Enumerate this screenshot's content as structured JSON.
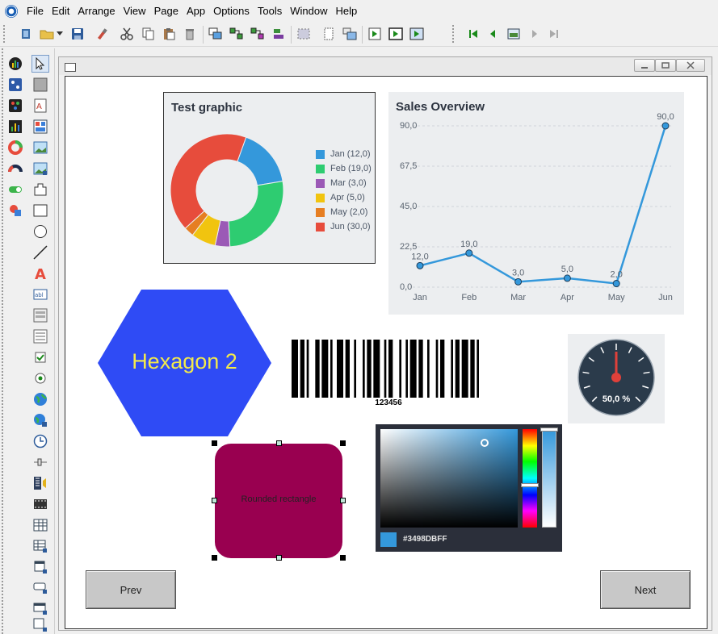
{
  "menu": {
    "items": [
      "File",
      "Edit",
      "Arrange",
      "View",
      "Page",
      "App",
      "Options",
      "Tools",
      "Window",
      "Help"
    ]
  },
  "toolbar": {
    "icons": [
      "new-screen-icon",
      "open-folder-icon",
      "dropdown-arrow-icon",
      "save-icon",
      "format-brush-icon",
      "cut-icon",
      "copy-icon",
      "paste-icon",
      "delete-icon",
      "bring-front-icon",
      "group-icon",
      "ungroup-icon",
      "align-icon",
      "select-all-icon",
      "new-page-icon",
      "pages-icon",
      "run-icon",
      "run-window-icon",
      "run-fullscreen-icon",
      "first-page-icon",
      "previous-page-icon",
      "page-icon",
      "next-page-icon",
      "last-page-icon"
    ]
  },
  "toolbox": {
    "icons": [
      "chart-icon",
      "pointer-icon",
      "layout-icon",
      "rectangle-fill-icon",
      "palette-icon",
      "text-doc-icon",
      "bar-chart-icon",
      "report-icon",
      "donut-icon",
      "image-icon",
      "gauge-icon",
      "image-edit-icon",
      "toggle-icon",
      "shape-icon",
      "cube-icon",
      "rectangle-icon",
      "ellipse-icon",
      "line-icon",
      "text-icon",
      "textbox-icon",
      "form-icon",
      "list-icon",
      "checkbox-icon",
      "radio-icon",
      "globe-icon",
      "web-icon",
      "clock-icon",
      "slider-icon",
      "media-icon",
      "film-icon",
      "table-icon",
      "table-edit-icon",
      "panel-icon",
      "window-icon",
      "dialog-icon",
      "subscreen-icon"
    ]
  },
  "pie_chart": {
    "title": "Test graphic",
    "legend": [
      "Jan (12,0)",
      "Feb (19,0)",
      "Mar (3,0)",
      "Apr (5,0)",
      "May (2,0)",
      "Jun (30,0)"
    ],
    "colors": [
      "#3498db",
      "#2ecc71",
      "#9b59b6",
      "#f1c40f",
      "#e67e22",
      "#e74c3c"
    ]
  },
  "line_chart": {
    "title": "Sales Overview",
    "color": "#3498db"
  },
  "chart_data": [
    {
      "type": "pie",
      "title": "Test graphic",
      "categories": [
        "Jan",
        "Feb",
        "Mar",
        "Apr",
        "May",
        "Jun"
      ],
      "values": [
        12,
        19,
        3,
        5,
        2,
        30
      ],
      "legend": "right"
    },
    {
      "type": "line",
      "title": "Sales Overview",
      "categories": [
        "Jan",
        "Feb",
        "Mar",
        "Apr",
        "May",
        "Jun"
      ],
      "values": [
        12.0,
        19.0,
        3.0,
        5.0,
        2.0,
        90.0
      ],
      "point_labels": [
        "12,0",
        "19,0",
        "3,0",
        "5,0",
        "2,0",
        "90,0"
      ],
      "ytick_labels": [
        "0,0",
        "22,5",
        "45,0",
        "67,5",
        "90,0"
      ],
      "ylim": [
        0,
        90
      ],
      "grid": true
    }
  ],
  "hexagon": {
    "label": "Hexagon 2",
    "fill": "#2f4bf5",
    "text_color": "#f3ea4b"
  },
  "barcode": {
    "value": "123456"
  },
  "gauge": {
    "value": 50.0,
    "label": "50,0 %"
  },
  "rounded_rect": {
    "label": "Rounded rectangle",
    "fill": "#990050"
  },
  "color_picker": {
    "value": "#3498DBFF",
    "color": "#3498db"
  },
  "buttons": {
    "prev": "Prev",
    "next": "Next"
  }
}
